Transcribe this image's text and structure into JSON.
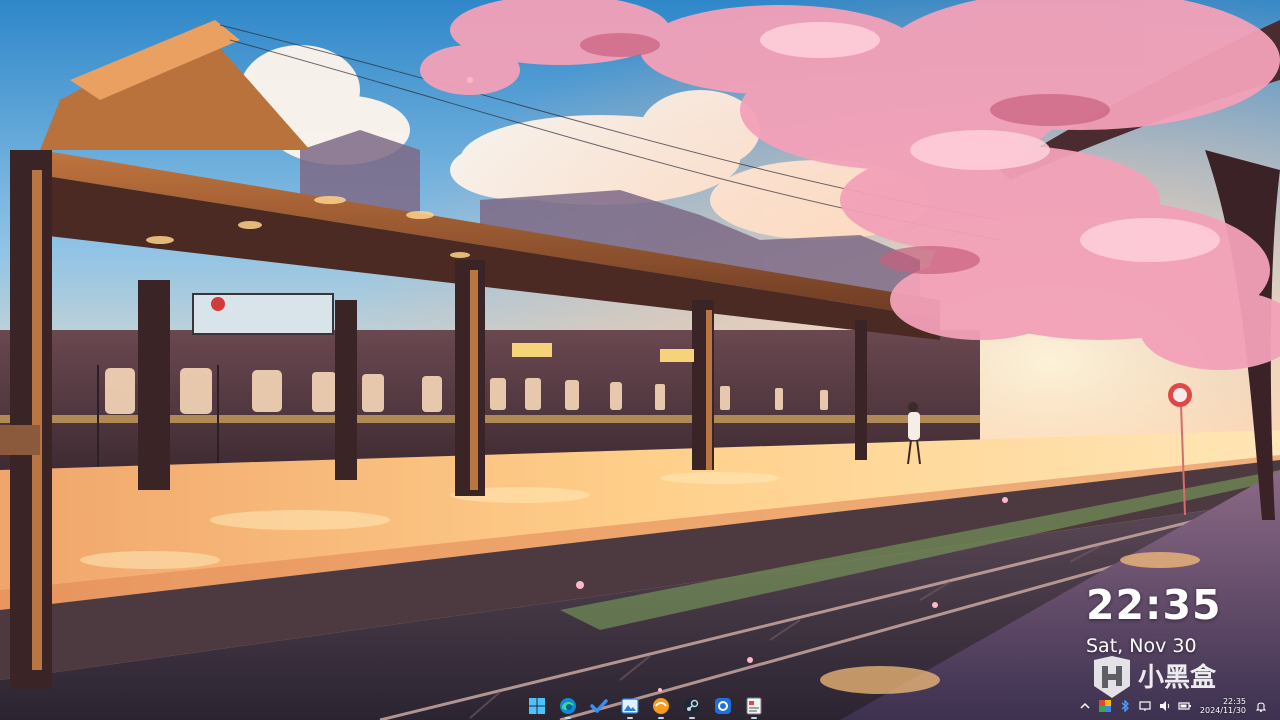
{
  "desktop": {
    "clock_widget": {
      "time": "22:35",
      "date": "Sat, Nov 30"
    },
    "watermark": {
      "brand_text": "小黑盒"
    },
    "taskbar": {
      "pinned": [
        {
          "name": "start-button",
          "icon": "windows-logo-icon"
        },
        {
          "name": "edge-button",
          "icon": "edge-icon"
        },
        {
          "name": "todo-button",
          "icon": "checkmark-icon"
        },
        {
          "name": "photos-button",
          "icon": "photos-icon"
        },
        {
          "name": "app-orange-button",
          "icon": "orange-globe-icon"
        },
        {
          "name": "steam-button",
          "icon": "steam-icon"
        },
        {
          "name": "app-blue-button",
          "icon": "blue-app-icon"
        },
        {
          "name": "app-doc-button",
          "icon": "document-icon"
        }
      ],
      "tray": {
        "icons": [
          "chevron-up-icon",
          "color-app-icon",
          "bluetooth-icon",
          "network-icon",
          "volume-icon",
          "battery-icon"
        ],
        "time": "22:35",
        "date": "2024/11/30",
        "notification_icon": "bell-icon"
      }
    },
    "colors": {
      "sky_top": "#2f87c9",
      "blossom": "#f3a1b8",
      "sunlight": "#ffd58a",
      "platform_shadow": "#5a3b44"
    }
  }
}
